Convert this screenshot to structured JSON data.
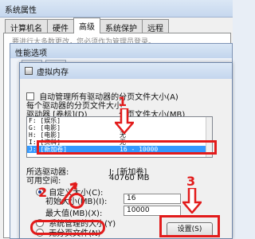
{
  "sys": {
    "title": "系统属性",
    "tabs": [
      "计算机名",
      "硬件",
      "高级",
      "系统保护",
      "远程"
    ],
    "active_tab": 2,
    "faint_line": "要进行大多数更改，您必须作为管理员登录。"
  },
  "perf": {
    "title": "性能选项"
  },
  "vm": {
    "title": "虚拟内存",
    "auto_manage_label": "自动管理所有驱动器的分页文件大小(A)",
    "per_drive_label": "每个驱动器的分页文件大小",
    "col_drive": "驱动器 [卷标](D)",
    "col_size": "分页文件大小(MB)",
    "drives": [
      {
        "drive": "F:   [娱乐]",
        "size": "无"
      },
      {
        "drive": "G:   [电影]",
        "size": "无"
      },
      {
        "drive": "H:   [电影]",
        "size": "无"
      },
      {
        "drive": "I:   [资料]",
        "size": "无"
      },
      {
        "drive": "J:   [新加卷]",
        "size": "16 - 10000"
      }
    ],
    "selected_drive_label": "所选驱动器:",
    "selected_drive_value": "J:  [新加卷]",
    "available_label": "可用空间:",
    "available_value": "40760 MB",
    "custom_size_label": "自定义大小(C):",
    "initial_label": "初始大小(MB)(I):",
    "initial_value": "16",
    "max_label": "最大值(MB)(X):",
    "max_value": "10000",
    "system_managed_label": "系统管理的大小(Y)",
    "no_paging_label": "无分页文件(N)",
    "set_button": "设置(S)"
  },
  "annotations": {
    "n1": "1",
    "n2": "2",
    "n3": "3"
  },
  "colors": {
    "annotation": "#e21b1b",
    "selection": "#3399ff"
  }
}
